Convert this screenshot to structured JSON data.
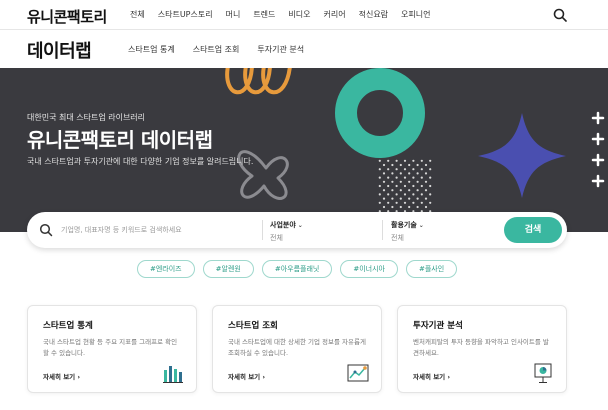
{
  "topnav": {
    "logo": "유니콘팩토리",
    "menu": [
      "전체",
      "스타트UP스토리",
      "머니",
      "트렌드",
      "비디오",
      "커리어",
      "적신요람",
      "오피니언"
    ],
    "search_icon": "search-icon"
  },
  "subhead": {
    "title": "데이터랩",
    "tabs": [
      "스타트업 통계",
      "스타트업 조회",
      "투자기관 분석"
    ]
  },
  "hero": {
    "kicker": "대한민국 최대 스타트업 라이브러리",
    "headline": "유니콘팩토리 데이터랩",
    "description": "국내 스타트업과 투자기관에 대한 다양한 기업 정보를 알려드립니다.",
    "colors": {
      "background": "#3a3a3f",
      "teal": "#3ab7a0",
      "orange": "#e79a3c",
      "blue": "#4a4fb0"
    }
  },
  "search": {
    "placeholder": "기업명, 대표자명 등 키워드로 검색하세요",
    "filter1_label": "사업분야",
    "filter1_value": "전체",
    "filter2_label": "활용기술",
    "filter2_value": "전체",
    "button": "검색"
  },
  "tags": [
    "#엔라이즈",
    "#알렌원",
    "#아우름플래닛",
    "#이너시아",
    "#플사인"
  ],
  "cards": [
    {
      "title": "스타트업 통계",
      "desc": "국내 스타트업 현황 등 주요 지표를 그래프로 확인 할 수 있습니다.",
      "more": "자세히 보기",
      "icon": "bar-chart-icon"
    },
    {
      "title": "스타트업 조회",
      "desc": "국내 스타트업에 대한 상세한 기업 정보를 자유롭게 조회하실 수 있습니다.",
      "more": "자세히 보기",
      "icon": "line-chart-icon"
    },
    {
      "title": "투자기관 분석",
      "desc": "벤처캐피탈의 투자 등향을 파악하고 인사이트를 발견하세요.",
      "more": "자세히 보기",
      "icon": "presentation-board-icon"
    }
  ]
}
